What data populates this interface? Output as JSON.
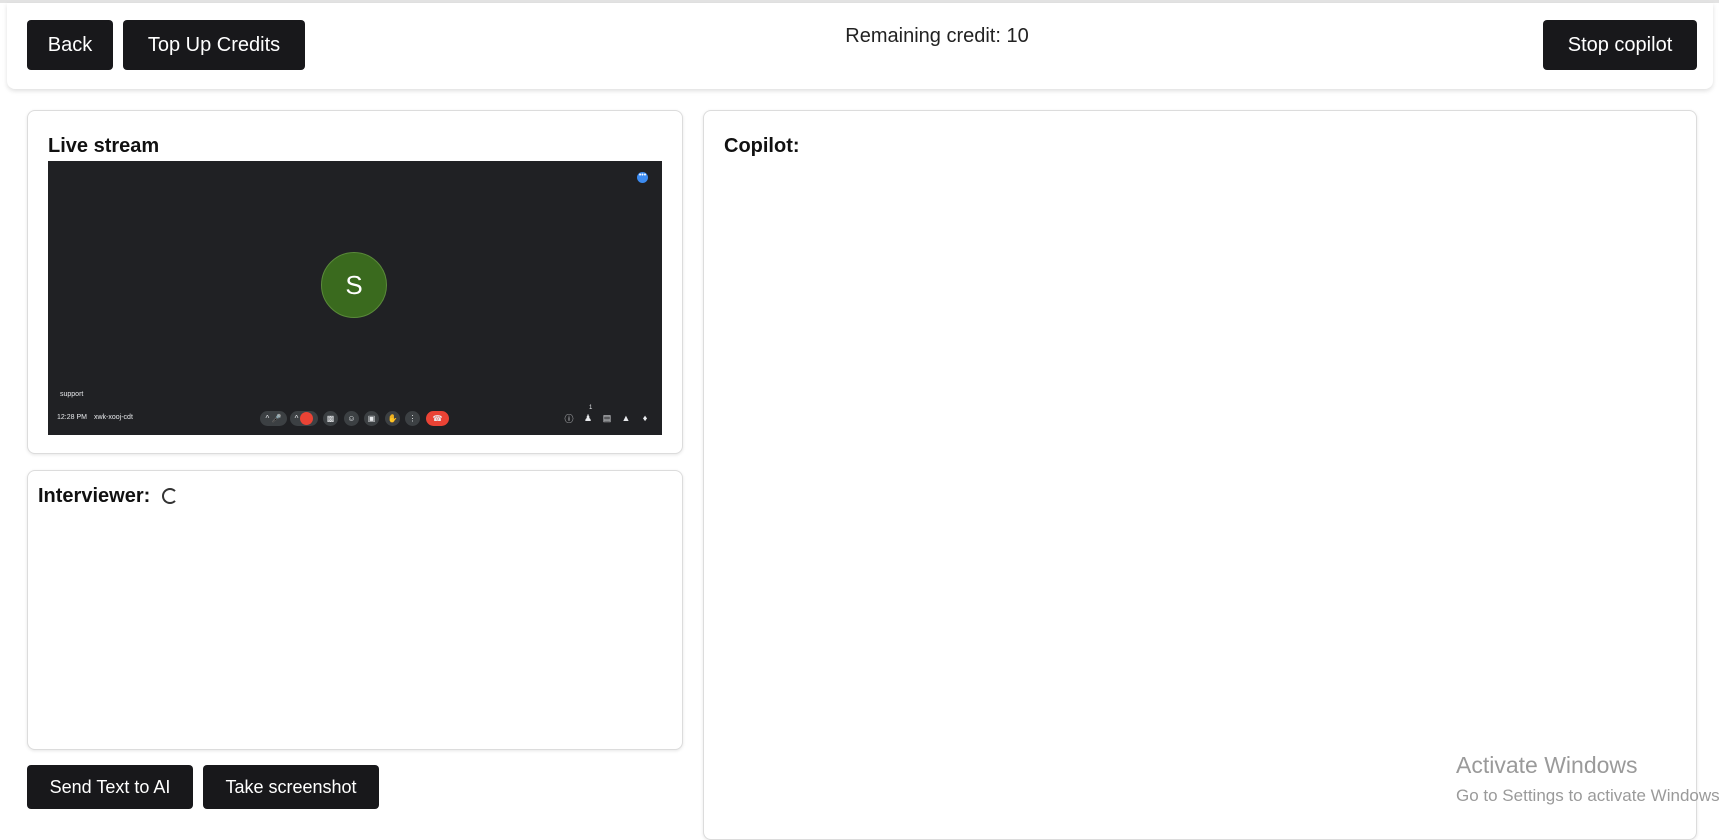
{
  "header": {
    "back_label": "Back",
    "topup_label": "Top Up Credits",
    "credit_text": "Remaining credit: 10",
    "stop_label": "Stop copilot"
  },
  "live_stream": {
    "title": "Live stream",
    "participant_initial": "S",
    "participant_name": "support",
    "time": "12:28 PM",
    "meeting_code": "xwk-xooj-cdt",
    "participants_count": "1"
  },
  "interviewer": {
    "title": "Interviewer:"
  },
  "copilot": {
    "title": "Copilot:"
  },
  "actions": {
    "send_text_label": "Send Text to AI",
    "screenshot_label": "Take screenshot"
  },
  "watermark": {
    "line1": "Activate Windows",
    "line2": "Go to Settings to activate Windows."
  },
  "colors": {
    "button_bg": "#18181b",
    "stream_bg": "#202124",
    "avatar_bg": "#3a6a1e",
    "end_call_red": "#ea4335"
  }
}
